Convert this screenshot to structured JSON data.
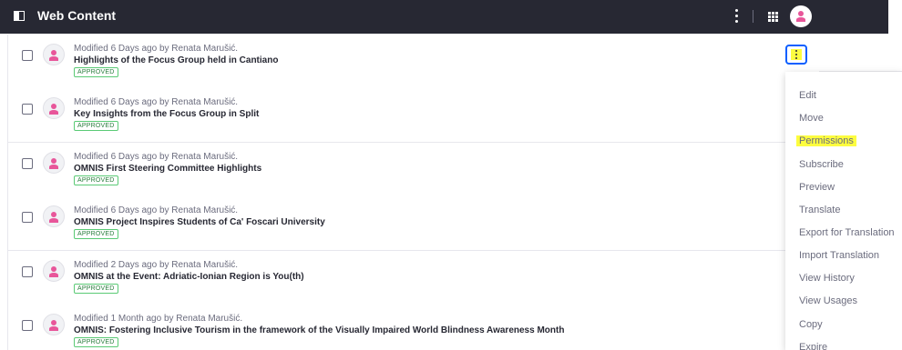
{
  "header": {
    "title": "Web Content"
  },
  "colors": {
    "topbar": "#272833",
    "accent": "#0b5fff",
    "highlight": "#fdfd3f",
    "approved": "#287d3c",
    "avatar": "#e8569a"
  },
  "rows": [
    {
      "meta": "Modified 6 Days ago by Renata Marušić.",
      "title": "Highlights of the Focus Group held in Cantiano",
      "status": "APPROVED"
    },
    {
      "meta": "Modified 6 Days ago by Renata Marušić.",
      "title": "Key Insights from the Focus Group in Split",
      "status": "APPROVED"
    },
    {
      "meta": "Modified 6 Days ago by Renata Marušić.",
      "title": "OMNIS First Steering Committee Highlights",
      "status": "APPROVED"
    },
    {
      "meta": "Modified 6 Days ago by Renata Marušić.",
      "title": "OMNIS Project Inspires Students of Ca' Foscari University",
      "status": "APPROVED"
    },
    {
      "meta": "Modified 2 Days ago by Renata Marušić.",
      "title": "OMNIS at the Event: Adriatic-Ionian Region is You(th)",
      "status": "APPROVED"
    },
    {
      "meta": "Modified 1 Month ago by Renata Marušić.",
      "title": "OMNIS: Fostering Inclusive Tourism in the framework of the Visually Impaired World Blindness Awareness Month",
      "status": "APPROVED"
    }
  ],
  "menu": {
    "items": [
      {
        "label": "Edit"
      },
      {
        "label": "Move"
      },
      {
        "label": "Permissions",
        "highlighted": true
      },
      {
        "label": "Subscribe"
      },
      {
        "label": "Preview"
      },
      {
        "label": "Translate"
      },
      {
        "label": "Export for Translation"
      },
      {
        "label": "Import Translation"
      },
      {
        "label": "View History"
      },
      {
        "label": "View Usages"
      },
      {
        "label": "Copy"
      },
      {
        "label": "Expire"
      }
    ]
  },
  "icons": {
    "sidebar_toggle": "sidebar-toggle-icon",
    "options": "ellipsis-vertical-icon",
    "apps": "apps-grid-icon",
    "user": "user-avatar-icon"
  }
}
